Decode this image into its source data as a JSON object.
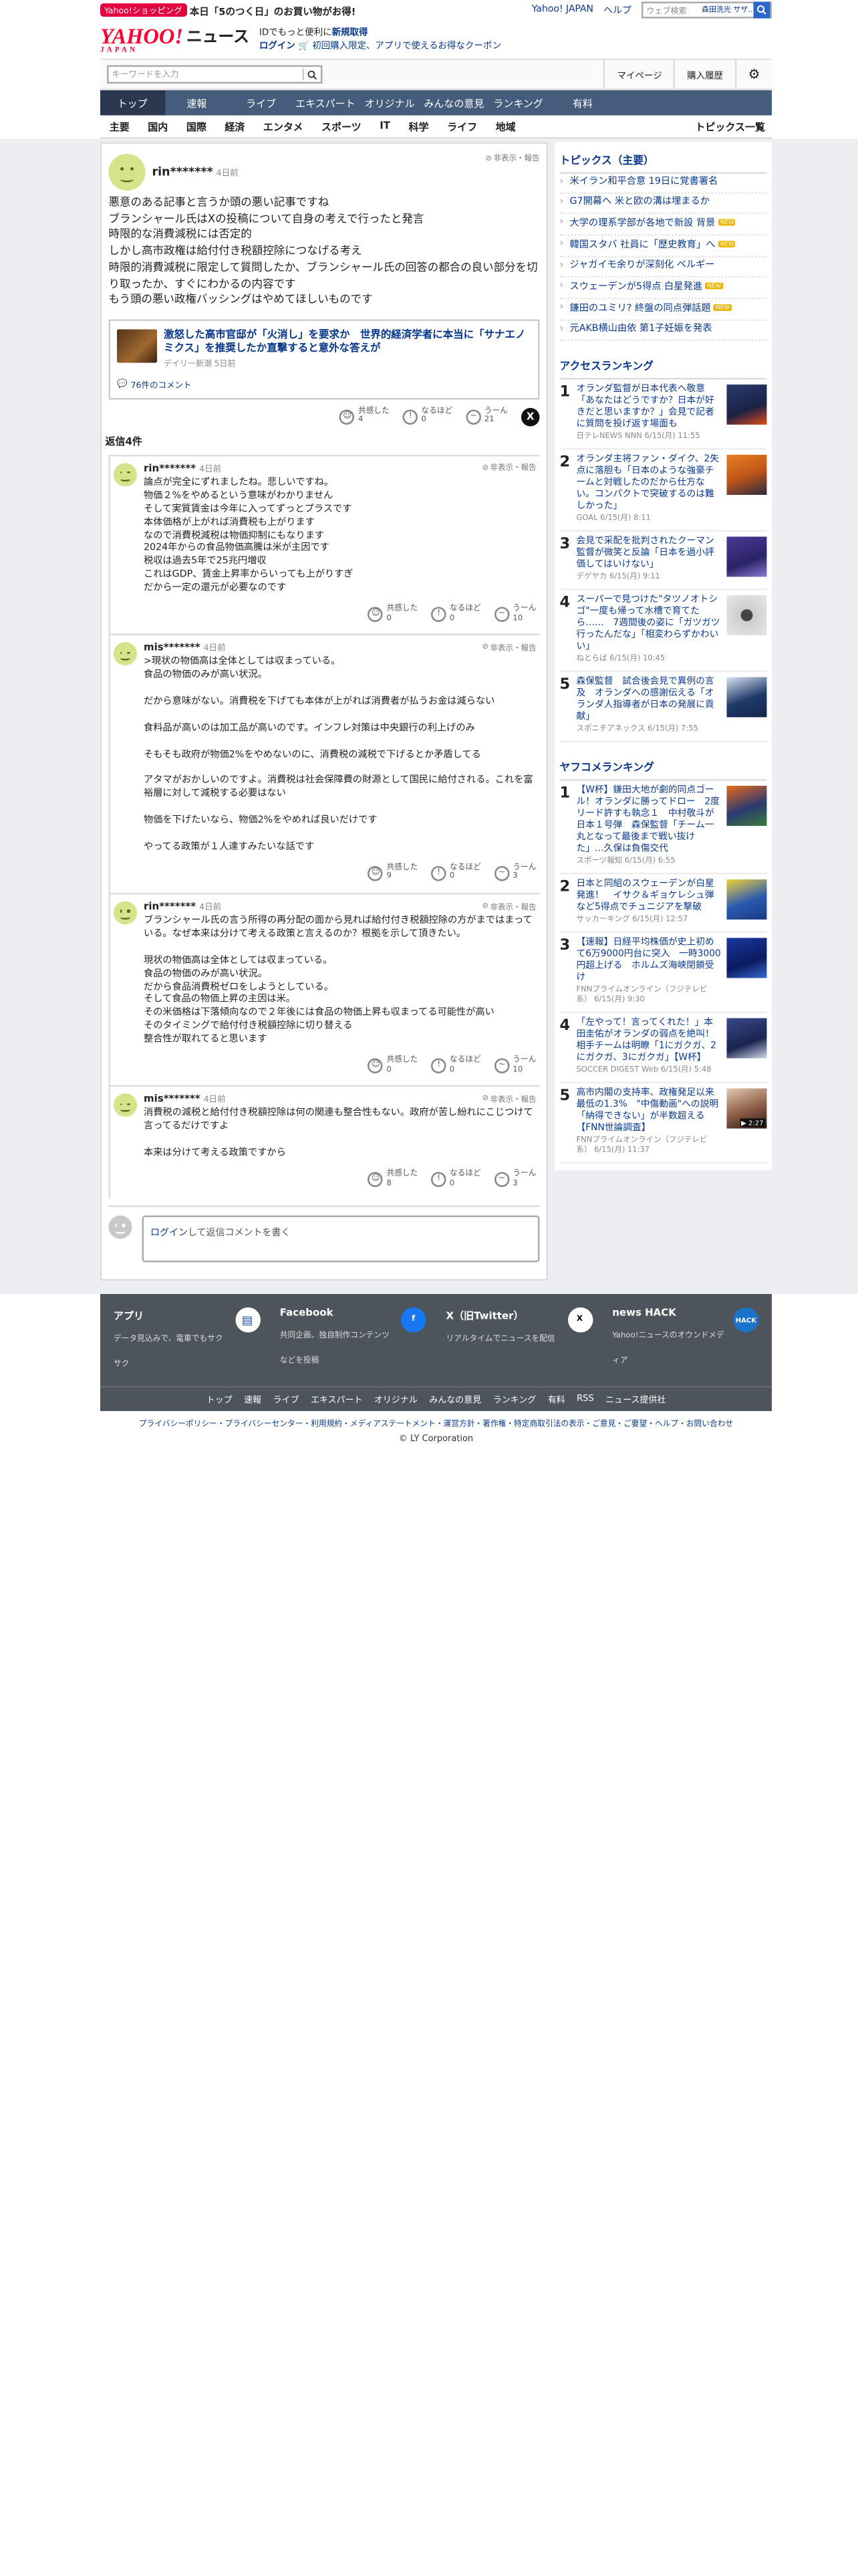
{
  "topbar": {
    "shop_badge": "Yahoo!ショッピング",
    "promo": "本日「5のつく日」のお買い物がお得!",
    "link1": "Yahoo! JAPAN",
    "link2": "ヘルプ",
    "search_placeholder": "ウェブ検索",
    "search_tag": "森田洗光 サザ..."
  },
  "header": {
    "logo": "YAHOO!",
    "logo_sub": "JAPAN",
    "news": "ニュース",
    "promo1": "IDでもっと便利に",
    "promo1_link": "新規取得",
    "promo2_link": "ログイン",
    "promo2": "初回購入限定、アプリで使えるお得なクーポン"
  },
  "search": {
    "placeholder": "キーワードを入力",
    "mypage": "マイページ",
    "history": "購入履歴"
  },
  "nav1": [
    "トップ",
    "速報",
    "ライブ",
    "エキスパート",
    "オリジナル",
    "みんなの意見",
    "ランキング",
    "有料"
  ],
  "nav2": [
    "主要",
    "国内",
    "国際",
    "経済",
    "エンタメ",
    "スポーツ",
    "IT",
    "科学",
    "ライフ",
    "地域"
  ],
  "nav2_right": "トピックス一覧",
  "main_comment": {
    "user": "rin*******",
    "time": "4日前",
    "hide": "非表示・報告",
    "text": "悪意のある記事と言うか頭の悪い記事ですね\nブランシャール氏はXの投稿について自身の考えで行ったと発言\n時限的な消費減税には否定的\nしかし高市政権は給付付き税額控除につなげる考え\n時限的消費減税に限定して質問したか、ブランシャール氏の回答の都合の良い部分を切り取ったか、すぐにわかるの内容です\nもう頭の悪い政権バッシングはやめてほしいものです",
    "card_title": "激怒した高市官邸が「火消し」を要求か　世界的経済学者に本当に「サナエノミクス」を推奨したか直撃すると意外な答えが",
    "card_source": "デイリー新潮 5日前",
    "card_comments": "76件のコメント",
    "r1": "共感した",
    "r1n": "4",
    "r2": "なるほど",
    "r2n": "0",
    "r3": "うーん",
    "r3n": "21"
  },
  "replies_header": "返信4件",
  "replies": [
    {
      "user": "rin*******",
      "time": "4日前",
      "hide": "非表示・報告",
      "text": "論点が完全にずれましたね。悲しいですね。\n物価２%をやめるという意味がわかりません\nそして実質賃金は今年に入ってずっとプラスです\n本体価格が上がれば消費税も上がります\nなので消費税減税は物価抑制にもなります\n2024年からの食品物価高騰は米が主因です\n税収は過去5年で25兆円増収\nこれはGDP、賃金上昇率からいっても上がりすぎ\nだから一定の還元が必要なのです",
      "r1": "共感した",
      "r1n": "0",
      "r2": "なるほど",
      "r2n": "0",
      "r3": "うーん",
      "r3n": "10"
    },
    {
      "user": "mis*******",
      "time": "4日前",
      "hide": "非表示・報告",
      "text": ">現状の物価高は全体としては収まっている。\n食品の物価のみが高い状況。\n\nだから意味がない。消費税を下げても本体が上がれば消費者が払うお金は減らない\n\n食料品が高いのは加工品が高いのです。インフレ対策は中央銀行の利上げのみ\n\nそもそも政府が物価2%をやめないのに、消費税の減税で下げるとか矛盾してる\n\nアタマがおかしいのですよ。消費税は社会保障費の財源として国民に給付される。これを富裕層に対して減税する必要はない\n\n物価を下げたいなら、物価2%をやめれば良いだけです\n\nやってる政策が１人達すみたいな話です",
      "r1": "共感した",
      "r1n": "9",
      "r2": "なるほど",
      "r2n": "0",
      "r3": "うーん",
      "r3n": "3"
    },
    {
      "user": "rin*******",
      "time": "4日前",
      "hide": "非表示・報告",
      "text": "ブランシャール氏の言う所得の再分配の面から見れば給付付き税額控除の方がまではまっている。なぜ本来は分けて考える政策と言えるのか？根拠を示して頂きたい。\n\n現状の物価高は全体としては収まっている。\n食品の物価のみが高い状況。\nだから食品消費税ゼロをしようとしている。\nそして食品の物価上昇の主因は米。\nその米価格は下落傾向なので２年後には食品の物価上昇も収まってる可能性が高い\nそのタイミングで給付付き税額控除に切り替える\n整合性が取れてると思います",
      "r1": "共感した",
      "r1n": "0",
      "r2": "なるほど",
      "r2n": "0",
      "r3": "うーん",
      "r3n": "10"
    },
    {
      "user": "mis*******",
      "time": "4日前",
      "hide": "非表示・報告",
      "text": "消費税の減税と給付付き税額控除は何の関連も整合性もない。政府が苦し紛れにこじつけて言ってるだけですよ\n\n本来は分けて考える政策ですから",
      "r1": "共感した",
      "r1n": "8",
      "r2": "なるほど",
      "r2n": "0",
      "r3": "うーん",
      "r3n": "3"
    }
  ],
  "reply_box": {
    "login": "ログイン",
    "text": "して返信コメントを書く"
  },
  "topics": {
    "title": "トピックス（主要）",
    "items": [
      {
        "t": "米イラン和平合意 19日に覚書署名",
        "n": ""
      },
      {
        "t": "G7開幕へ 米と欧の溝は埋まるか",
        "n": ""
      },
      {
        "t": "大学の理系学部が各地で新設 背景",
        "n": "NEW"
      },
      {
        "t": "韓国スタバ 社員に「歴史教育」へ",
        "n": "NEW"
      },
      {
        "t": "ジャガイモ余りが深刻化 ベルギー",
        "n": ""
      },
      {
        "t": "スウェーデンが5得点 白星発進",
        "n": "NEW"
      },
      {
        "t": "鎌田のユミリ? 終盤の同点弾話題",
        "n": "NEW"
      },
      {
        "t": "元AKB横山由依 第1子妊娠を発表",
        "n": ""
      }
    ]
  },
  "access_ranking": {
    "title": "アクセスランキング",
    "items": [
      {
        "n": "1",
        "t": "オランダ監督が日本代表へ敬意「あなたはどうですか？日本が好きだと思いますか？」会見で記者に質問を投げ返す場面も",
        "s": "日テレNEWS NNN 6/15(月) 11:55"
      },
      {
        "n": "2",
        "t": "オランダ主将ファン・ダイク、2失点に落胆も「日本のような強豪チームと対戦したのだから仕方ない。コンパクトで突破するのは難しかった」",
        "s": "GOAL 6/15(月) 8:11"
      },
      {
        "n": "3",
        "t": "会見で采配を批判されたクーマン監督が微笑と反論「日本を過小評価してはいけない」",
        "s": "デゲヤカ 6/15(月) 9:11"
      },
      {
        "n": "4",
        "t": "スーパーで見つけた\"タツノオトシゴ\"一度も帰って水槽で育てたら……　7週間後の姿に「ガツガツ行ったんだな」「相変わらずかわいい」",
        "s": "ねとらば 6/15(月) 10:45"
      },
      {
        "n": "5",
        "t": "森保監督　試合後会見で異例の言及　オランダへの感謝伝える「オランダ人指導者が日本の発展に貢献」",
        "s": "スポニチアネックス 6/15(月) 7:55"
      }
    ]
  },
  "yahoo_ranking": {
    "title": "ヤフコメランキング",
    "items": [
      {
        "n": "1",
        "t": "【W杯】鎌田大地が劇的同点ゴール！オランダに勝ってドロー　2度リード許すも執念１　中村敬斗が日本１号弾　森保監督「チーム一丸となって最後まで戦い抜けた」…久保は負傷交代",
        "s": "スポーツ報知 6/15(月) 6:55",
        "d": ""
      },
      {
        "n": "2",
        "t": "日本と同組のスウェーデンが白星発進！　イサク＆ギョケレシュ弾など5得点でチュニジアを撃破",
        "s": "サッカーキング 6/15(月) 12:57",
        "d": ""
      },
      {
        "n": "3",
        "t": "【速報】日経平均株価が史上初めて6万9000円台に突入　一時3000円超上げる　ホルムズ海峡閉鎖受け",
        "s": "FNNプライムオンライン（フジテレビ系） 6/15(月) 9:30",
        "d": ""
      },
      {
        "n": "4",
        "t": "「左やって！言ってくれた！」本田圭佑がオランダの弱点を絶叫！相手チームは明瞭「1にガクガ、2にガクガ、3にガクガ」【W杯】",
        "s": "SOCCER DIGEST Web 6/15(月) 5:48",
        "d": ""
      },
      {
        "n": "5",
        "t": "高市内閣の支持率、政権発足以来最低の1.3%　\"中傷動画\"への説明「納得できない」が半数超える【FNN世論調査】",
        "s": "FNNプライムオンライン（フジテレビ系） 6/15(月) 11:37",
        "d": "2:27"
      }
    ]
  },
  "footer": {
    "apps": [
      {
        "t": "アプリ",
        "d": "データ見込みで、電車でもサクサク"
      },
      {
        "t": "Facebook",
        "d": "共同企画、独自制作コンテンツなどを投稿"
      },
      {
        "t": "X（旧Twitter）",
        "d": "リアルタイムでニュースを配信"
      },
      {
        "t": "news HACK",
        "d": "Yahoo!ニュースのオウンドメディア"
      }
    ],
    "nav": [
      "トップ",
      "速報",
      "ライブ",
      "エキスパート",
      "オリジナル",
      "みんなの意見",
      "ランキング",
      "有料",
      "RSS",
      "ニュース提供社"
    ],
    "links": "プライバシーポリシー・プライバシーセンター・利用規約・メディアステートメント・運営方針・著作権・特定商取引法の表示・ご意見・ご要望・ヘルプ・お問い合わせ",
    "copyright": "© LY Corporation"
  }
}
